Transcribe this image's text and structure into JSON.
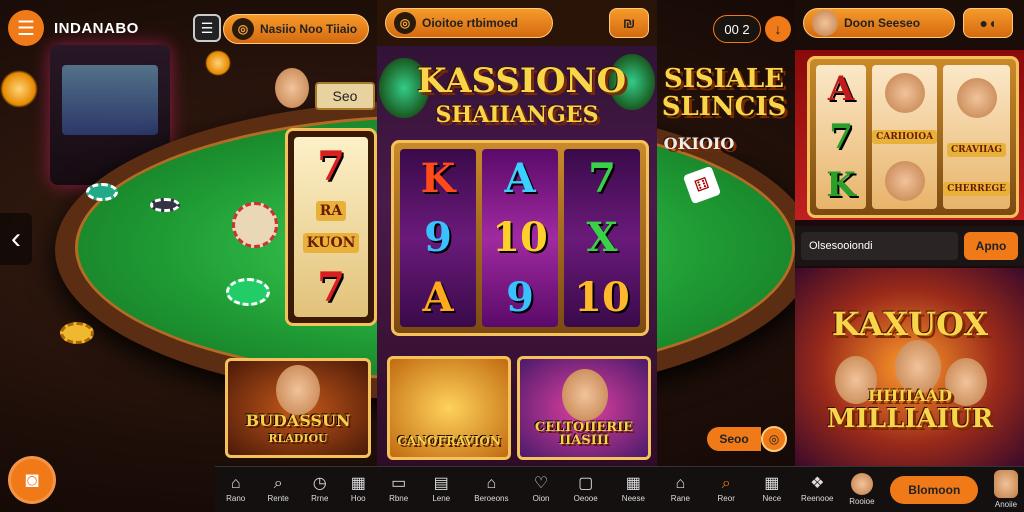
{
  "app": {
    "brand": "INDANABO"
  },
  "left": {
    "tbox": "☰"
  },
  "panel1": {
    "pill_text": "Nasiio Noo Tiiaio",
    "tag": "Seo",
    "reel_syms": [
      "7",
      "7"
    ],
    "reel_mid": "RA",
    "reel_mid2": "KUON",
    "tile_text": "BUDASSUN",
    "tile_text2": "RLADIOU",
    "nav": [
      "Rano",
      "Rente",
      "Rrne",
      "Hoo"
    ]
  },
  "panel2": {
    "pill_text": "Oioitoe rtbimoed",
    "title": "KASSIONO",
    "subtitle": "SHAIIANGES",
    "reel1": [
      "K",
      "9",
      "A"
    ],
    "reel2": [
      "A",
      "10",
      "9"
    ],
    "reel3": [
      "7",
      "X",
      "10"
    ],
    "tile1": "CANOFRAVION",
    "tile2a": "CELTOIIERIE",
    "tile2b": "IIASIII",
    "nav": [
      "Rbne",
      "Lene",
      "Beroeons",
      "Oion",
      "Oeooe",
      "Neese"
    ]
  },
  "panel3": {
    "counter": "00 2",
    "title": "SISIALE",
    "subtitle": "SLINCIS",
    "label": "OKIOIO",
    "pill": "Seoo",
    "nav": [
      "Rane",
      "Reor",
      "Nece"
    ]
  },
  "panel4": {
    "pill_text": "Doon Seeseo",
    "input_text": "Olsesooiondi",
    "apply": "Apno",
    "reel_syms": [
      "A",
      "7",
      "K"
    ],
    "reel_mid": "CARIIOIOA",
    "reel_right": "CRAVIIAG",
    "reel_right2": "CHERREGE",
    "title": "KAXUOX",
    "sub1": "HHIIAAD",
    "sub2": "MILLIAIUR",
    "cta": "Blomoon",
    "nav": [
      "Reenooe",
      "Rooioe",
      "Anoiie"
    ]
  },
  "colors": {
    "accent": "#f07a18",
    "felt": "#1f9a33",
    "gold": "#f5c15a"
  }
}
